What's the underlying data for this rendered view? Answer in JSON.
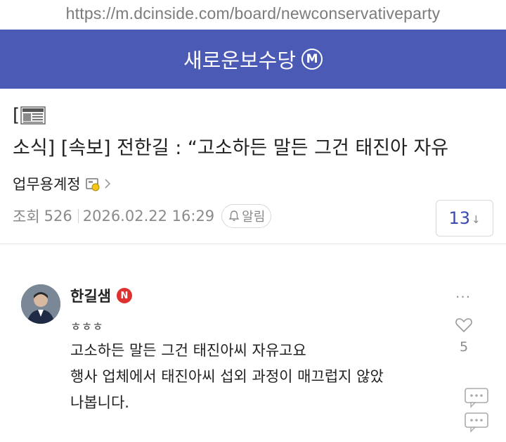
{
  "browser": {
    "url": "https://m.dcinside.com/board/newconservativeparty"
  },
  "header": {
    "gallery_name": "새로운보수당",
    "minor_badge": "M"
  },
  "post": {
    "bracket": "[",
    "news_icon": "newspaper-icon",
    "title": "소식] [속보] 전한길 : “고소하든 말든 그건 태진아 자유",
    "author": "업무용계정",
    "views_label": "조회",
    "views": "526",
    "datetime": "2026.02.22 16:29",
    "alarm_label": "알림",
    "comment_count": "13",
    "comment_arrow": "↓"
  },
  "comment": {
    "author": "한길샘",
    "badge": "N",
    "more": "···",
    "lines": [
      "ㅎㅎㅎ",
      "고소하든 말든 그건 태진아씨 자유고요",
      "행사 업체에서 태진아씨 섭외 과정이 매끄럽지 않았",
      "나봅니다."
    ],
    "likes": "5"
  },
  "colors": {
    "header_bg": "#4b5ab5",
    "count_color": "#3b4ab0",
    "badge_red": "#e03131"
  }
}
